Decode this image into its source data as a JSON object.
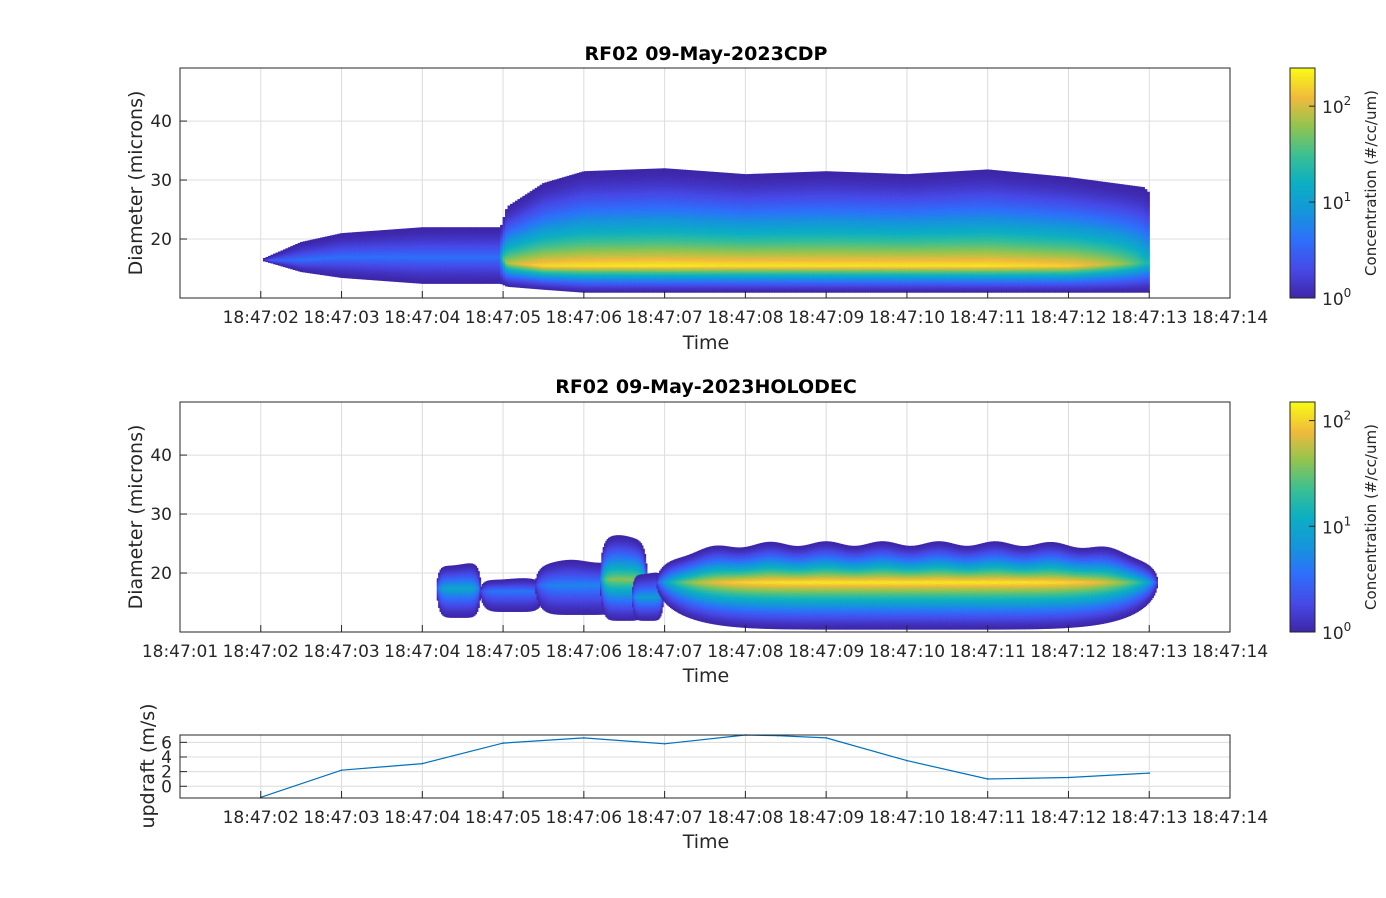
{
  "chart_data": [
    {
      "type": "heatmap",
      "title": "RF02 09-May-2023CDP",
      "xlabel": "Time",
      "ylabel": "Diameter (microns)",
      "x_ticks": [
        "18:47:02",
        "18:47:03",
        "18:47:04",
        "18:47:05",
        "18:47:06",
        "18:47:07",
        "18:47:08",
        "18:47:09",
        "18:47:10",
        "18:47:11",
        "18:47:12",
        "18:47:13",
        "18:47:14"
      ],
      "xlim": [
        "18:47:01",
        "18:47:14"
      ],
      "y_ticks": [
        20,
        30,
        40
      ],
      "ylim": [
        10,
        49
      ],
      "grid": true,
      "colorscale": "parula",
      "colorbar": {
        "label": "Concentration (#/cc/um)",
        "scale": "log",
        "range": [
          1,
          250
        ],
        "ticks": [
          {
            "base": "10",
            "exp": "0",
            "value": 1
          },
          {
            "base": "10",
            "exp": "1",
            "value": 10
          },
          {
            "base": "10",
            "exp": "2",
            "value": 100
          }
        ]
      },
      "x_seconds": [
        1.0,
        1.5,
        2.0,
        3.0,
        3.97,
        4.05,
        4.5,
        5.0,
        6.0,
        7.0,
        8.0,
        9.0,
        10.0,
        11.0,
        11.93,
        12.0
      ],
      "upper_edge_microns": [
        16.5,
        19.5,
        21,
        22,
        22,
        25.5,
        29.5,
        31.5,
        32,
        31,
        31.5,
        31,
        31.8,
        30.5,
        28.8,
        27.8
      ],
      "lower_edge_microns": [
        16.5,
        14.5,
        13.5,
        12.5,
        12.5,
        12,
        11.5,
        11,
        11,
        11,
        11,
        11,
        11,
        11,
        11,
        11
      ],
      "peak_diameter_microns": [
        16.5,
        16.5,
        17,
        17,
        17,
        16,
        15.5,
        15.5,
        15.5,
        15.5,
        15.5,
        15.5,
        15.5,
        15.5,
        16,
        16
      ],
      "peak_concentration": [
        3,
        4,
        4,
        4,
        4,
        80,
        180,
        200,
        210,
        200,
        200,
        200,
        200,
        160,
        25,
        20
      ]
    },
    {
      "type": "heatmap",
      "title": "RF02 09-May-2023HOLODEC",
      "xlabel": "Time",
      "ylabel": "Diameter (microns)",
      "x_ticks": [
        "18:47:01",
        "18:47:02",
        "18:47:03",
        "18:47:04",
        "18:47:05",
        "18:47:06",
        "18:47:07",
        "18:47:08",
        "18:47:09",
        "18:47:10",
        "18:47:11",
        "18:47:12",
        "18:47:13",
        "18:47:14"
      ],
      "xlim": [
        "18:47:01",
        "18:47:14"
      ],
      "y_ticks": [
        20,
        30,
        40
      ],
      "ylim": [
        10,
        49
      ],
      "grid": true,
      "colorscale": "parula",
      "colorbar": {
        "label": "Concentration (#/cc/um)",
        "scale": "log",
        "range": [
          1,
          150
        ],
        "ticks": [
          {
            "base": "10",
            "exp": "0",
            "value": 1
          },
          {
            "base": "10",
            "exp": "1",
            "value": 10
          },
          {
            "base": "10",
            "exp": "2",
            "value": 100
          }
        ]
      },
      "clusters": [
        {
          "t_start_s": 3.18,
          "t_end_s": 3.72,
          "d_min": 12.5,
          "d_max": 21.5,
          "peak_d": 17.5,
          "peak_conc": 10
        },
        {
          "t_start_s": 3.72,
          "t_end_s": 4.5,
          "d_min": 13.5,
          "d_max": 19,
          "peak_d": 17,
          "peak_conc": 4
        },
        {
          "t_start_s": 4.4,
          "t_end_s": 5.5,
          "d_min": 13,
          "d_max": 22,
          "peak_d": 18,
          "peak_conc": 5
        },
        {
          "t_start_s": 5.2,
          "t_end_s": 5.78,
          "d_min": 12,
          "d_max": 26,
          "peak_d": 19,
          "peak_conc": 40
        },
        {
          "t_start_s": 5.6,
          "t_end_s": 5.98,
          "d_min": 12,
          "d_max": 20,
          "peak_d": 16,
          "peak_conc": 8
        },
        {
          "t_start_s": 5.9,
          "t_end_s": 12.1,
          "d_min": 10.5,
          "d_max": 25,
          "peak_d": 18.5,
          "peak_conc": 130
        }
      ]
    },
    {
      "type": "line",
      "xlabel": "Time",
      "ylabel": "updraft (m/s)",
      "x_ticks": [
        "18:47:02",
        "18:47:03",
        "18:47:04",
        "18:47:05",
        "18:47:06",
        "18:47:07",
        "18:47:08",
        "18:47:09",
        "18:47:10",
        "18:47:11",
        "18:47:12",
        "18:47:13",
        "18:47:14"
      ],
      "xlim": [
        "18:47:01",
        "18:47:14"
      ],
      "y_ticks": [
        0,
        2,
        4,
        6
      ],
      "ylim": [
        -1.6,
        7
      ],
      "grid": true,
      "color": "#0072bd",
      "x": [
        "18:47:02",
        "18:47:03",
        "18:47:04",
        "18:47:05",
        "18:47:06",
        "18:47:07",
        "18:47:08",
        "18:47:08.4",
        "18:47:09",
        "18:47:10",
        "18:47:11",
        "18:47:12",
        "18:47:13"
      ],
      "values": [
        -1.5,
        2.2,
        3.1,
        5.9,
        6.6,
        5.8,
        7.0,
        6.9,
        6.6,
        3.5,
        1.0,
        1.2,
        1.8
      ]
    }
  ]
}
